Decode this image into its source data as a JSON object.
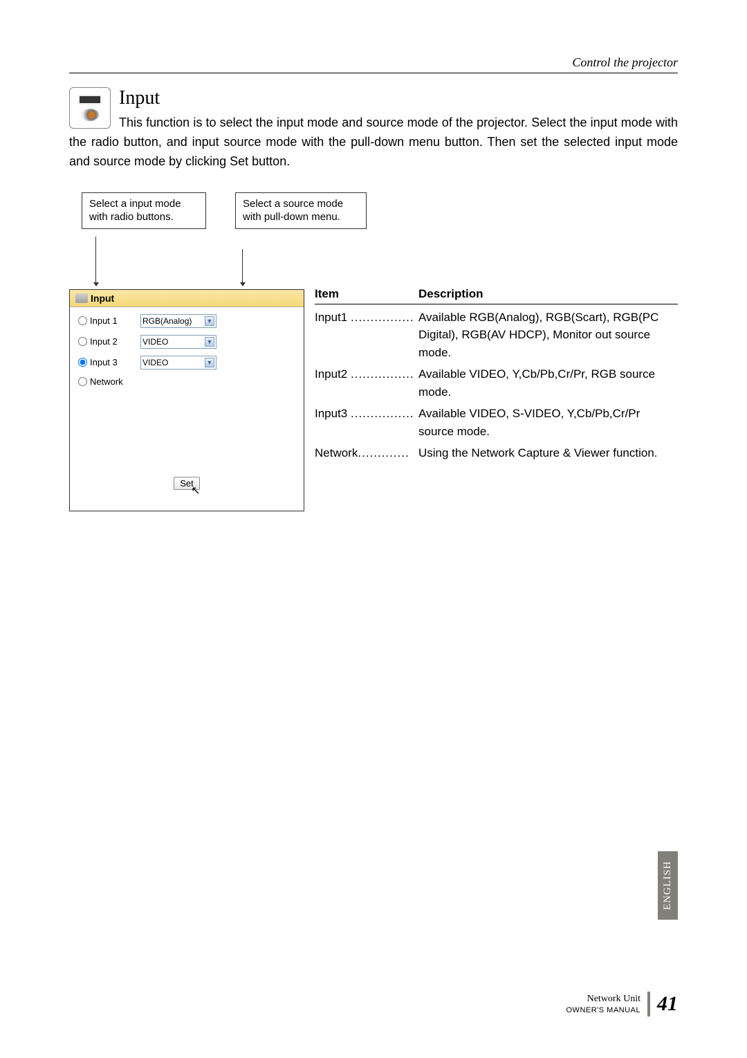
{
  "header": {
    "breadcrumb": "Control the projector"
  },
  "section": {
    "title": "Input",
    "paragraph": "This function is to select the input mode and source mode of the projector. Select the input mode with the radio button, and input source mode with the pull-down menu button. Then set the selected input mode and source mode by clicking ",
    "set_word": "Set",
    "paragraph_after": " button."
  },
  "annotation1": "Select a input mode with radio buttons.",
  "annotation2": "Select a source mode with pull-down menu.",
  "ui": {
    "panel_title": "Input",
    "rows": [
      {
        "label": "Input 1",
        "select": "RGB(Analog)",
        "checked": false
      },
      {
        "label": "Input 2",
        "select": "VIDEO",
        "checked": false
      },
      {
        "label": "Input 3",
        "select": "VIDEO",
        "checked": true
      },
      {
        "label": "Network",
        "select": "",
        "checked": false
      }
    ],
    "set_button": "Set"
  },
  "table": {
    "header_item": "Item",
    "header_desc": "Description",
    "rows": [
      {
        "item": "Input1",
        "dots": "................",
        "desc": "Available RGB(Analog), RGB(Scart), RGB(PC Digital), RGB(AV HDCP), Monitor out source mode."
      },
      {
        "item": "Input2",
        "dots": "................",
        "desc": "Available VIDEO, Y,Cb/Pb,Cr/Pr, RGB source mode."
      },
      {
        "item": "Input3",
        "dots": "................",
        "desc": "Available VIDEO, S-VIDEO, Y,Cb/Pb,Cr/Pr source mode."
      },
      {
        "item": "Network",
        "dots": ".............",
        "desc": "Using the Network Capture & Viewer function."
      }
    ]
  },
  "side_tab": "ENGLISH",
  "footer": {
    "line1": "Network Unit",
    "line2": "OWNER'S MANUAL",
    "page": "41"
  }
}
